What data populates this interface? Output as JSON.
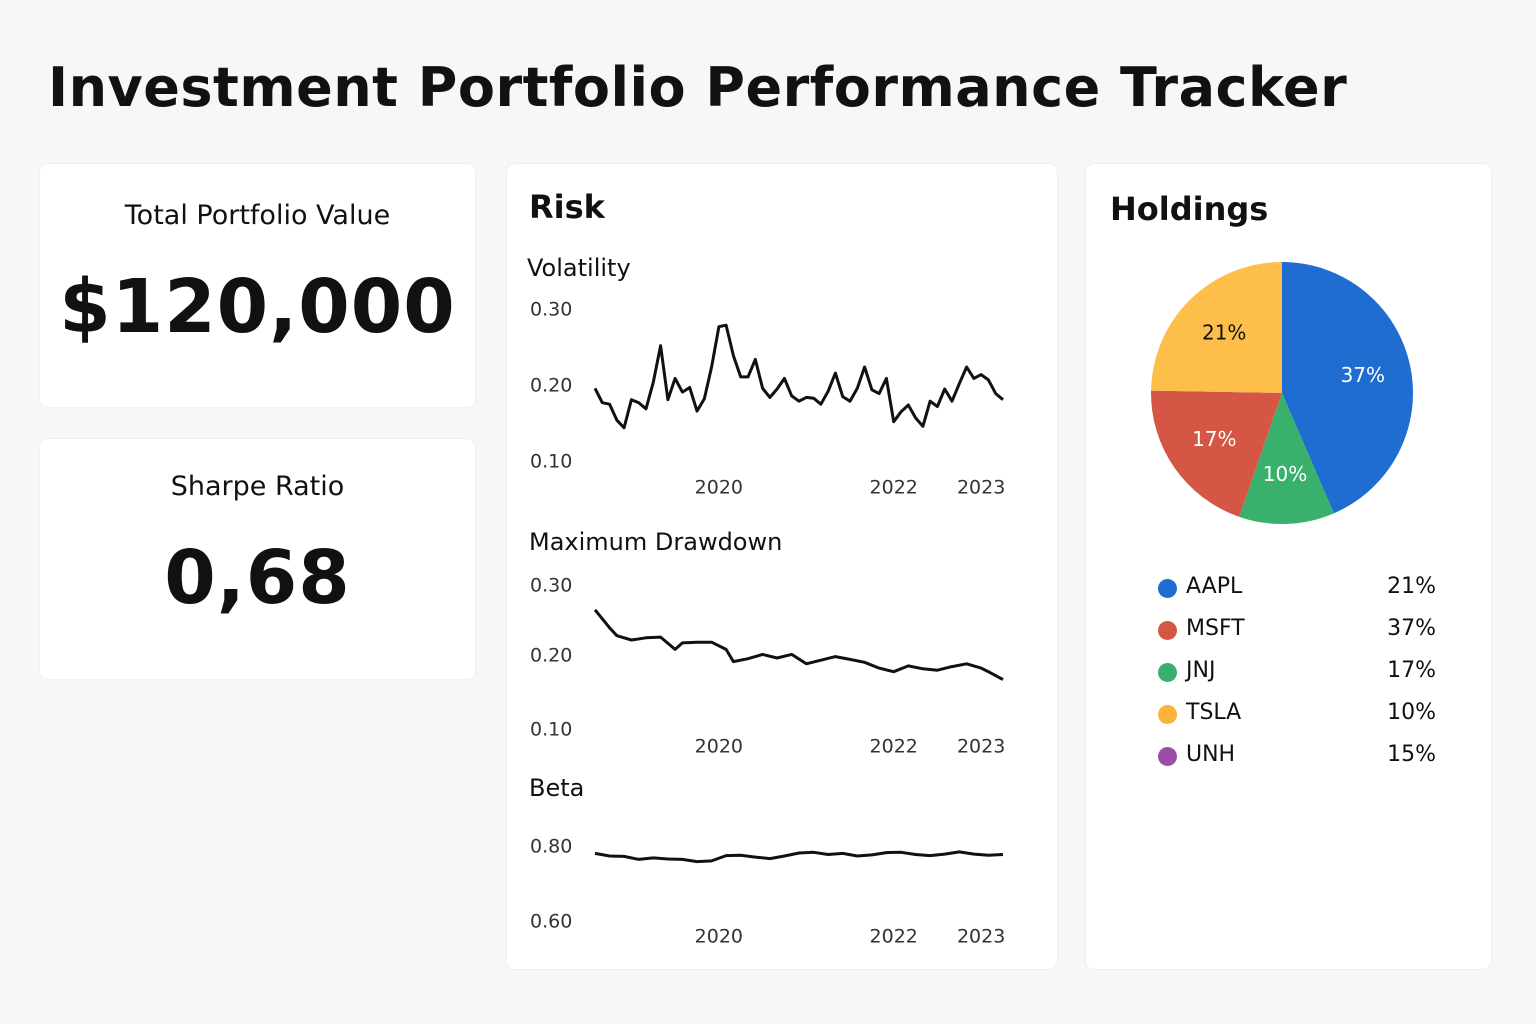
{
  "page": {
    "title": "Investment Portfolio Performance Tracker"
  },
  "kpis": {
    "portfolio_value": {
      "label": "Total Portfolio Value",
      "value": "$120,000"
    },
    "sharpe": {
      "label": "Sharpe Ratio",
      "value": "0,68"
    }
  },
  "risk": {
    "title": "Risk"
  },
  "holdings": {
    "title": "Holdings"
  },
  "chart_data": [
    {
      "type": "line",
      "title": "Volatility",
      "x_ticks": [
        "2020",
        "2022",
        "2023"
      ],
      "y_ticks": [
        "0.30",
        "0.20",
        "0.10"
      ],
      "ylim": [
        0.1,
        0.3
      ],
      "x_range": [
        "2018-10",
        "2023-06"
      ],
      "grid": false,
      "series": [
        {
          "x": [
            "2018-10",
            "2018-11",
            "2018-12",
            "2019-01",
            "2019-02",
            "2019-03",
            "2019-04",
            "2019-05",
            "2019-06",
            "2019-07",
            "2019-08",
            "2019-09",
            "2019-10",
            "2019-11",
            "2019-12",
            "2020-01",
            "2020-02",
            "2020-03",
            "2020-04",
            "2020-05",
            "2020-06",
            "2020-07",
            "2020-08",
            "2020-09",
            "2020-10",
            "2020-11",
            "2020-12",
            "2021-01",
            "2021-02",
            "2021-03",
            "2021-04",
            "2021-05",
            "2021-06",
            "2021-07",
            "2021-08",
            "2021-09",
            "2021-10",
            "2021-11",
            "2021-12",
            "2022-01",
            "2022-02",
            "2022-03",
            "2022-04",
            "2022-05",
            "2022-06",
            "2022-07",
            "2022-08",
            "2022-09",
            "2022-10",
            "2022-11",
            "2022-12",
            "2023-01",
            "2023-02",
            "2023-03",
            "2023-04",
            "2023-05",
            "2023-06"
          ],
          "values": [
            0.197,
            0.178,
            0.176,
            0.155,
            0.145,
            0.182,
            0.178,
            0.17,
            0.205,
            0.253,
            0.182,
            0.21,
            0.192,
            0.198,
            0.167,
            0.183,
            0.225,
            0.278,
            0.28,
            0.24,
            0.212,
            0.212,
            0.235,
            0.197,
            0.185,
            0.196,
            0.21,
            0.187,
            0.18,
            0.185,
            0.184,
            0.176,
            0.193,
            0.217,
            0.186,
            0.18,
            0.197,
            0.225,
            0.195,
            0.19,
            0.21,
            0.153,
            0.166,
            0.175,
            0.158,
            0.147,
            0.18,
            0.173,
            0.196,
            0.18,
            0.203,
            0.225,
            0.21,
            0.215,
            0.208,
            0.19,
            0.182
          ]
        }
      ]
    },
    {
      "type": "line",
      "title": "Maximum Drawdown",
      "x_ticks": [
        "2020",
        "2022",
        "2023"
      ],
      "y_ticks": [
        "0.30",
        "0.20",
        "0.10"
      ],
      "ylim": [
        0.1,
        0.3
      ],
      "x_range": [
        "2018-10",
        "2023-06"
      ],
      "grid": false,
      "series": [
        {
          "x": [
            "2018-10",
            "2018-12",
            "2019-01",
            "2019-03",
            "2019-05",
            "2019-07",
            "2019-09",
            "2019-10",
            "2019-12",
            "2020-02",
            "2020-04",
            "2020-05",
            "2020-07",
            "2020-09",
            "2020-11",
            "2021-01",
            "2021-03",
            "2021-05",
            "2021-07",
            "2021-09",
            "2021-11",
            "2022-01",
            "2022-03",
            "2022-05",
            "2022-07",
            "2022-09",
            "2022-11",
            "2023-01",
            "2023-03",
            "2023-04",
            "2023-06"
          ],
          "values": [
            0.267,
            0.242,
            0.231,
            0.225,
            0.228,
            0.229,
            0.212,
            0.221,
            0.222,
            0.222,
            0.212,
            0.195,
            0.199,
            0.205,
            0.2,
            0.205,
            0.192,
            0.197,
            0.202,
            0.198,
            0.194,
            0.186,
            0.181,
            0.189,
            0.185,
            0.183,
            0.188,
            0.192,
            0.186,
            0.181,
            0.17
          ]
        }
      ]
    },
    {
      "type": "line",
      "title": "Beta",
      "x_ticks": [
        "2020",
        "2022",
        "2023"
      ],
      "y_ticks": [
        "0.80",
        "0.60"
      ],
      "ylim": [
        0.6,
        0.8
      ],
      "x_range": [
        "2018-10",
        "2023-06"
      ],
      "grid": false,
      "series": [
        {
          "x": [
            "2018-10",
            "2018-12",
            "2019-02",
            "2019-04",
            "2019-06",
            "2019-08",
            "2019-10",
            "2019-12",
            "2020-02",
            "2020-04",
            "2020-06",
            "2020-08",
            "2020-10",
            "2020-12",
            "2021-02",
            "2021-04",
            "2021-06",
            "2021-08",
            "2021-10",
            "2021-12",
            "2022-02",
            "2022-04",
            "2022-06",
            "2022-08",
            "2022-10",
            "2022-12",
            "2023-02",
            "2023-04",
            "2023-06"
          ],
          "values": [
            0.783,
            0.776,
            0.775,
            0.767,
            0.771,
            0.768,
            0.767,
            0.761,
            0.763,
            0.777,
            0.778,
            0.773,
            0.769,
            0.776,
            0.784,
            0.786,
            0.78,
            0.783,
            0.776,
            0.779,
            0.785,
            0.786,
            0.78,
            0.777,
            0.781,
            0.787,
            0.781,
            0.778,
            0.78
          ]
        }
      ]
    },
    {
      "type": "pie",
      "title": "",
      "slices": [
        {
          "label": "37%",
          "value": 37,
          "color": "#1f6dd1",
          "text_color": "#ffffff"
        },
        {
          "label": "10%",
          "value": 10,
          "color": "#39b06b",
          "text_color": "#ffffff"
        },
        {
          "label": "17%",
          "value": 17,
          "color": "#d55645",
          "text_color": "#ffffff"
        },
        {
          "label": "21%",
          "value": 21,
          "color": "#fdbf49",
          "text_color": "#111111"
        }
      ],
      "legend": [
        {
          "name": "AAPL",
          "value": "21%",
          "color": "#1f6dd1"
        },
        {
          "name": "MSFT",
          "value": "37%",
          "color": "#d55645"
        },
        {
          "name": "JNJ",
          "value": "17%",
          "color": "#39b06b"
        },
        {
          "name": "TSLA",
          "value": "10%",
          "color": "#fdb23a"
        },
        {
          "name": "UNH",
          "value": "15%",
          "color": "#9b4ea5"
        }
      ],
      "legend_position": "bottom"
    }
  ]
}
